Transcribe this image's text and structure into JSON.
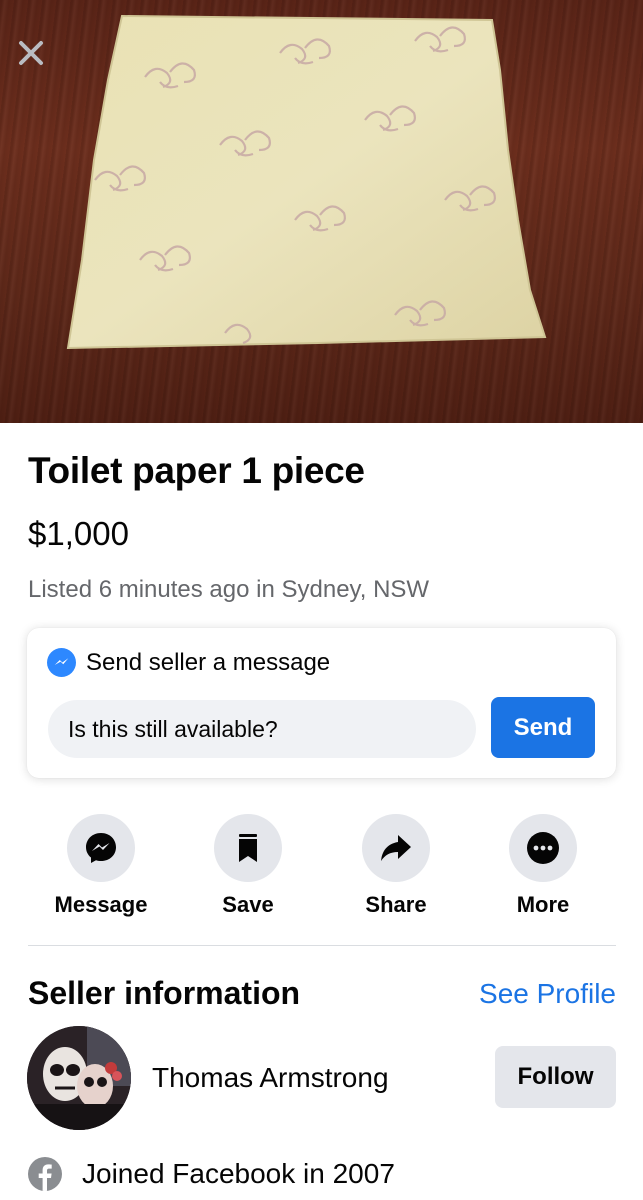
{
  "listing": {
    "title": "Toilet paper 1 piece",
    "price": "$1,000",
    "listed_info": "Listed 6 minutes ago in Sydney, NSW"
  },
  "message_card": {
    "heading": "Send seller a message",
    "input_value": "Is this still available?",
    "send_label": "Send"
  },
  "actions": [
    {
      "label": "Message",
      "icon": "messenger-icon"
    },
    {
      "label": "Save",
      "icon": "bookmark-icon"
    },
    {
      "label": "Share",
      "icon": "share-arrow-icon"
    },
    {
      "label": "More",
      "icon": "more-dots-icon"
    }
  ],
  "seller": {
    "heading": "Seller information",
    "see_profile": "See Profile",
    "name": "Thomas Armstrong",
    "follow_label": "Follow",
    "joined": "Joined Facebook in 2007"
  },
  "colors": {
    "accent": "#1b74e4",
    "secondary_text": "#65676b",
    "button_gray": "#e4e6eb"
  }
}
